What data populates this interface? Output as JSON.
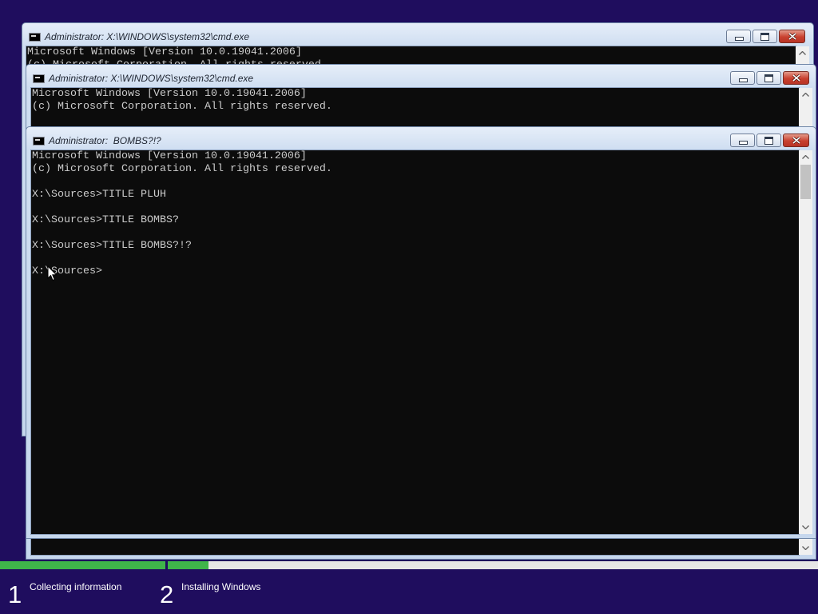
{
  "windows": [
    {
      "title": "Administrator: X:\\WINDOWS\\system32\\cmd.exe",
      "icon": "cmd-icon",
      "lines": [
        "Microsoft Windows [Version 10.0.19041.2006]",
        "(c) Microsoft Corporation. All rights reserved."
      ]
    },
    {
      "title": "Administrator: X:\\WINDOWS\\system32\\cmd.exe",
      "icon": "cmd-icon",
      "lines": [
        "Microsoft Windows [Version 10.0.19041.2006]",
        "(c) Microsoft Corporation. All rights reserved."
      ]
    },
    {
      "title": "Administrator:  BOMBS?!?",
      "icon": "cmd-icon",
      "lines": [
        "Microsoft Windows [Version 10.0.19041.2006]",
        "(c) Microsoft Corporation. All rights reserved.",
        "",
        "X:\\Sources>TITLE PLUH",
        "",
        "X:\\Sources>TITLE BOMBS?",
        "",
        "X:\\Sources>TITLE BOMBS?!?",
        "",
        "X:\\Sources>"
      ]
    }
  ],
  "setup_steps": [
    {
      "number": "1",
      "label": "Collecting information",
      "progress": 1.0
    },
    {
      "number": "2",
      "label": "Installing Windows",
      "progress": 0.063
    }
  ],
  "icons": {
    "window": "cmd-icon",
    "minimize": "minimize-icon",
    "maximize": "maximize-icon",
    "close": "close-icon",
    "scroll_up": "chevron-up-icon",
    "scroll_down": "chevron-down-icon",
    "pointer": "mouse-pointer-icon"
  },
  "colors": {
    "background": "#1f0d5e",
    "progress_fill": "#3fb54a",
    "progress_track": "#e6e6e6",
    "console_background": "#0c0c0c",
    "console_text": "#cccccc",
    "close_button": "#c8402f",
    "window_frame": "#c6d7ed"
  }
}
